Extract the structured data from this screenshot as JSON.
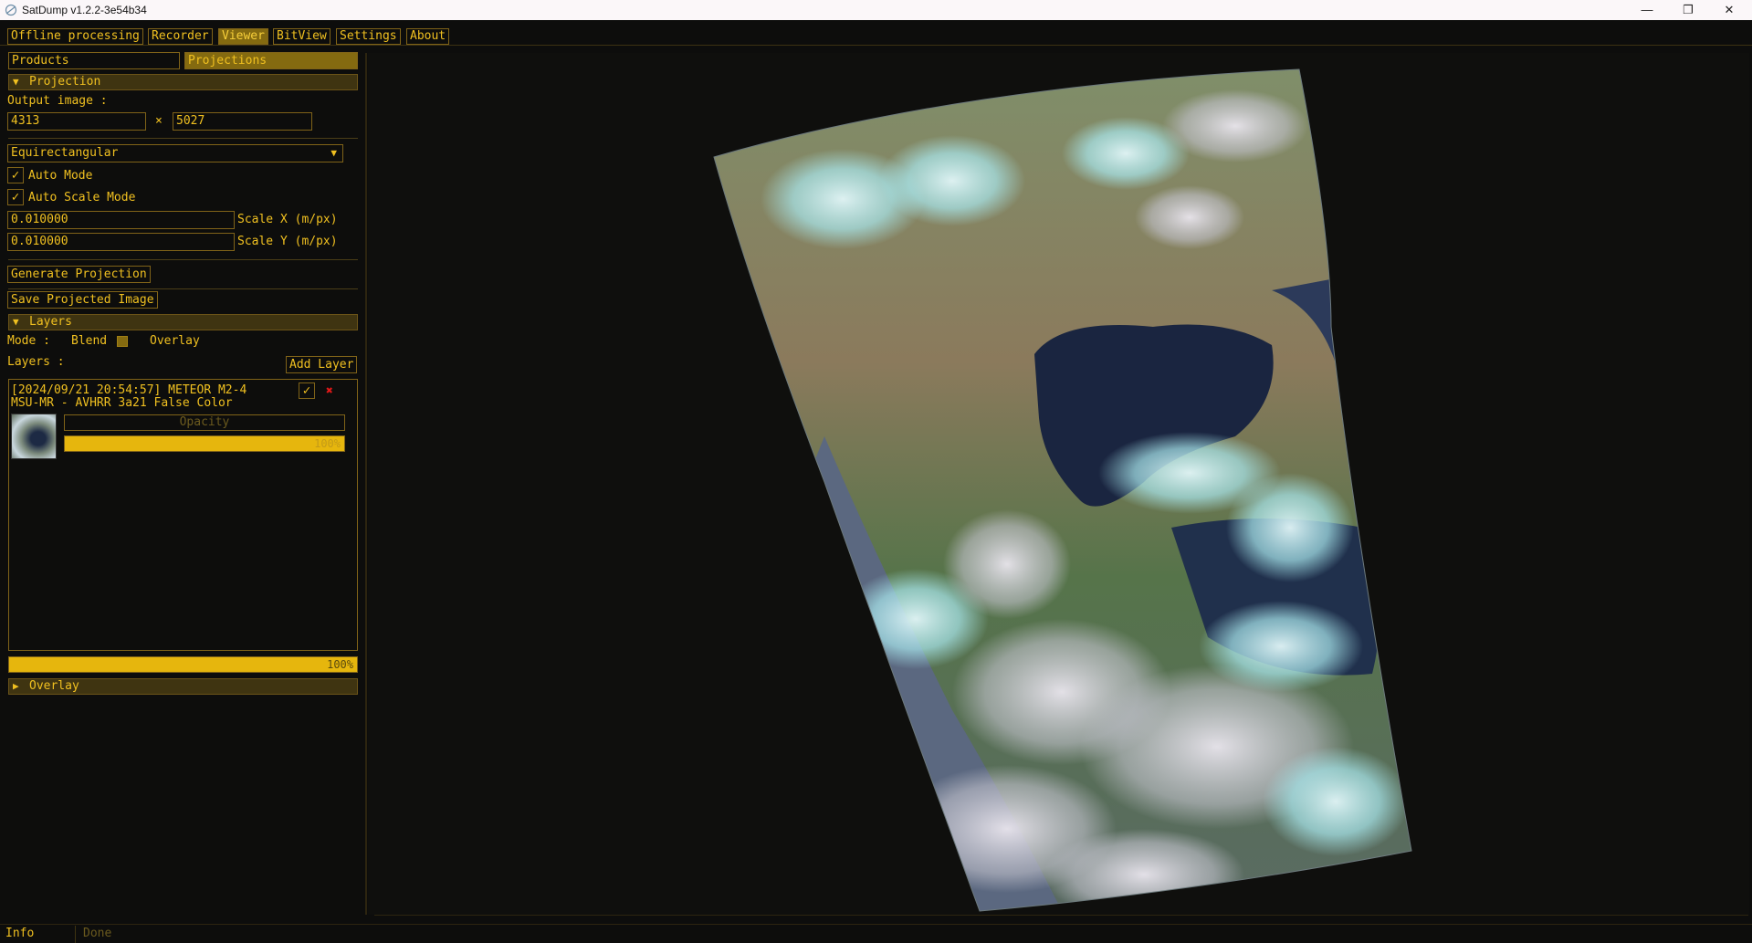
{
  "window": {
    "title": "SatDump v1.2.2-3e54b34",
    "minimize_glyph": "—",
    "maximize_glyph": "❐",
    "close_glyph": "✕"
  },
  "menu": {
    "tabs": [
      {
        "label": "Offline processing"
      },
      {
        "label": "Recorder"
      },
      {
        "label": "Viewer"
      },
      {
        "label": "BitView"
      },
      {
        "label": "Settings"
      },
      {
        "label": "About"
      }
    ],
    "active_tab": "Viewer"
  },
  "panel": {
    "subtabs": [
      {
        "label": "Products"
      },
      {
        "label": "Projections"
      }
    ],
    "active_subtab": "Projections",
    "projection": {
      "header": "Projection",
      "output_image_label": "Output image :",
      "width": "4313",
      "times": "×",
      "height": "5027",
      "projection_type": "Equirectangular",
      "auto_mode": {
        "label": "Auto Mode",
        "checked": true
      },
      "auto_scale_mode": {
        "label": "Auto Scale Mode",
        "checked": true
      },
      "scale_x": {
        "value": "0.010000",
        "label": "Scale X (m/px)"
      },
      "scale_y": {
        "value": "0.010000",
        "label": "Scale Y (m/px)"
      },
      "generate_button": "Generate Projection",
      "save_button": "Save Projected Image"
    },
    "layers": {
      "header": "Layers",
      "mode_label": "Mode :",
      "mode_blend": "Blend",
      "mode_overlay": "Overlay",
      "list_label": "Layers :",
      "add_button": "Add Layer",
      "items": [
        {
          "title_line1": "[2024/09/21 20:54:57] METEOR M2-4",
          "title_line2": "MSU-MR - AVHRR 3a21 False Color",
          "enabled": true,
          "opacity_label": "Opacity",
          "opacity_text": "100%",
          "opacity": 1.0
        }
      ],
      "progress_text": "100%",
      "progress": 1.0
    },
    "overlay": {
      "header": "Overlay"
    }
  },
  "status": {
    "info_label": "Info",
    "message": "Done"
  },
  "colors": {
    "accent": "#f0c020",
    "active_bg": "#846a10",
    "header_bg": "#3f3411",
    "border": "#806318",
    "background": "#0d0d0c",
    "remove_red": "#e01818"
  },
  "icons": {
    "expand_open": "▼",
    "expand_closed": "▶",
    "check": "✓",
    "remove": "✖",
    "combo_arrow": "▼"
  }
}
